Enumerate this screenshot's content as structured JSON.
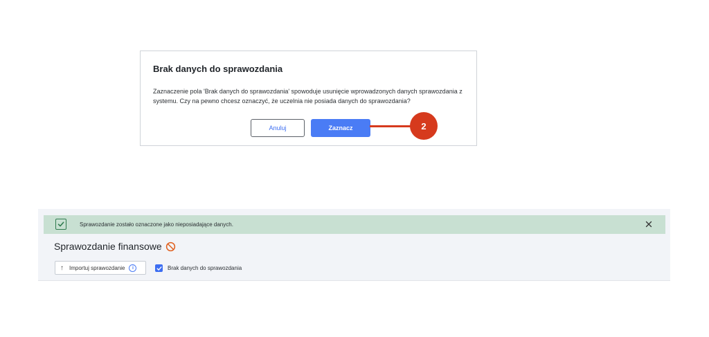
{
  "dialog": {
    "title": "Brak danych do sprawozdania",
    "body": "Zaznaczenie pola 'Brak danych do sprawozdania' spowoduje usunięcie wprowadzonych danych sprawozdania z systemu. Czy na pewno chcesz oznaczyć, że uczelnia nie posiada danych do sprawozdania?",
    "cancel_label": "Anuluj",
    "confirm_label": "Zaznacz"
  },
  "callout": {
    "number": "2",
    "color": "#d63a1d"
  },
  "alert": {
    "message": "Sprawozdanie zostało oznaczone jako nieposiadające danych.",
    "icon": "check-square-icon",
    "close_icon": "close-icon",
    "background": "#c8e0d2"
  },
  "section": {
    "title": "Sprawozdanie finansowe",
    "status_icon": "no-entry-icon"
  },
  "toolbar": {
    "import_label": "Importuj sprawozdanie",
    "checkbox_label": "Brak danych do sprawozdania",
    "checkbox_checked": true
  },
  "colors": {
    "primary": "#4a7cf5",
    "accent_red": "#d63a1d"
  }
}
